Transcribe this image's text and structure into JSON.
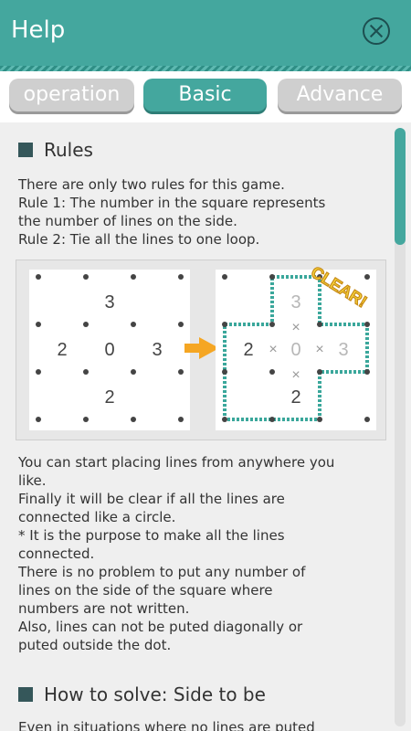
{
  "header": {
    "title": "Help",
    "close_icon": "close-icon"
  },
  "tabs": [
    {
      "label": "operation",
      "active": false
    },
    {
      "label": "Basic",
      "active": true
    },
    {
      "label": "Advance",
      "active": false
    }
  ],
  "rules": {
    "heading": "Rules",
    "intro_lines": [
      "There are only two rules for this game.",
      "Rule 1: The number in the square represents",
      "the number of lines on the side.",
      "Rule 2: Tie all the lines to one loop."
    ],
    "diagram": {
      "left_numbers": [
        "3",
        "2",
        "0",
        "3",
        "2"
      ],
      "right_numbers": [
        "3",
        "2",
        "0",
        "3",
        "2"
      ],
      "cross_mark": "×",
      "badge": "CLEAR!",
      "arrow_icon": "arrow-right-icon"
    },
    "body_lines": [
      "You can start placing lines from anywhere you",
      "like.",
      "Finally it will be clear if all the lines are",
      "connected like a circle.",
      "* It is the purpose to make all the lines",
      "connected.",
      "There is no problem to put any number of",
      "lines on the side of the square where",
      "numbers are not written.",
      "Also, lines can not be puted diagonally or",
      "puted outside the dot."
    ]
  },
  "how_to_solve": {
    "heading": "How to solve: Side to be",
    "partial_line": "Even in situations where no lines are puted"
  },
  "colors": {
    "teal": "#44a79e",
    "dark_teal": "#35575a",
    "gray_tab": "#cfcfcf",
    "arrow": "#f5a623",
    "badge_yellow": "#f7d43a"
  }
}
